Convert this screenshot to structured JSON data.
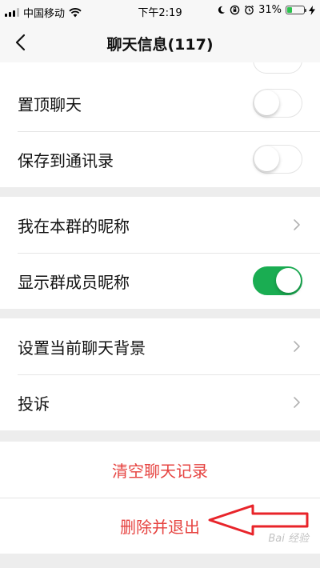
{
  "status_bar": {
    "carrier": "中国移动",
    "time": "下午2:19",
    "battery_percent": "31%",
    "battery_level": 0.31
  },
  "nav": {
    "title": "聊天信息(117)"
  },
  "settings": {
    "pin_chat": {
      "label": "置顶聊天",
      "enabled": false
    },
    "save_to_contacts": {
      "label": "保存到通讯录",
      "enabled": false
    },
    "my_group_nickname": {
      "label": "我在本群的昵称"
    },
    "show_member_nicknames": {
      "label": "显示群成员昵称",
      "enabled": true
    },
    "set_chat_background": {
      "label": "设置当前聊天背景"
    },
    "report": {
      "label": "投诉"
    }
  },
  "actions": {
    "clear_history": "清空聊天记录",
    "delete_and_exit": "删除并退出"
  },
  "colors": {
    "toggle_on": "#1aad52",
    "danger_text": "#e64340",
    "annotation_arrow": "#e8242a"
  },
  "watermark": "Bai 经验"
}
